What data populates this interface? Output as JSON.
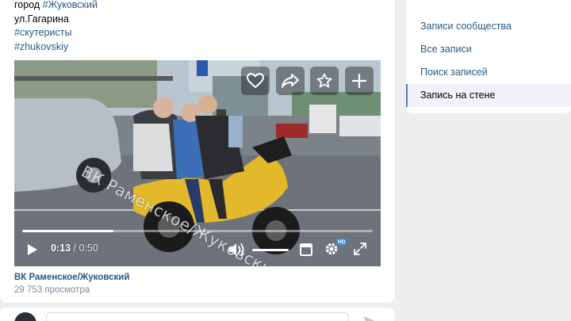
{
  "post": {
    "line1_prefix": "город ",
    "line1_tag": "#Жуковский",
    "line2": "ул.Гагарина",
    "tag2": "#скутеристы",
    "tag3": "#zhukovskiy"
  },
  "video": {
    "watermark": "ВК Раменское/Жуковский",
    "time_current": "0:13",
    "time_separator": " / ",
    "time_total": "0:50",
    "progress": 0.26,
    "volume": 1.0,
    "hd_badge": "HD",
    "actions": [
      "heart-icon",
      "share-icon",
      "star-icon",
      "plus-icon"
    ],
    "controls": [
      "play-icon",
      "volume-icon",
      "fullscreen-window-icon",
      "settings-icon",
      "expand-icon"
    ]
  },
  "footer": {
    "source": "ВК Раменское/Жуковский",
    "views": "29 753 просмотра"
  },
  "sidebar": {
    "items": [
      {
        "label": "Записи сообщества"
      },
      {
        "label": "Все записи"
      },
      {
        "label": "Поиск записей"
      },
      {
        "label": "Запись на стене"
      }
    ],
    "active_index": 3
  },
  "colors": {
    "link": "#2a5885",
    "accent": "#5181b8",
    "hd": "#3f8ae0",
    "page_bg": "#edeef0"
  }
}
